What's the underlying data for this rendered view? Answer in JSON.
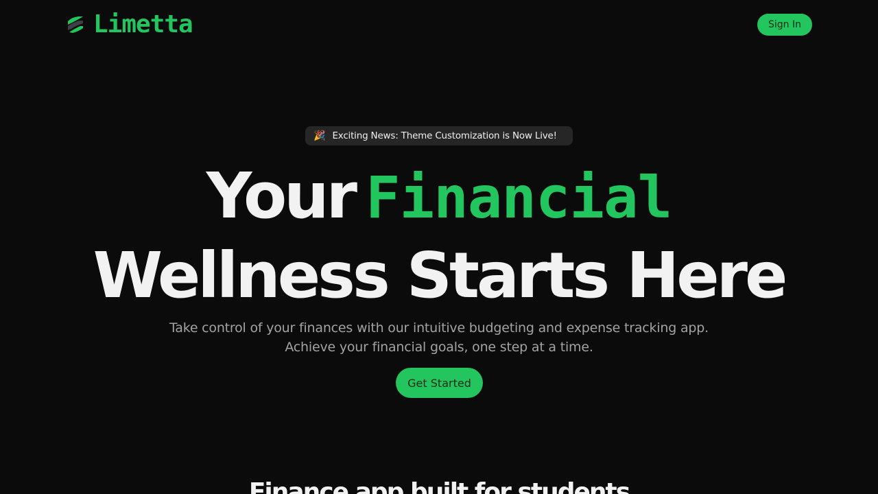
{
  "header": {
    "brand_name": "Limetta",
    "logo_icon": "limetta-logo-icon",
    "signin_label": "Sign In"
  },
  "announcement": {
    "icon": "party-popper-icon",
    "icon_glyph": "🎉",
    "text": "Exciting News: Theme Customization is Now Live!"
  },
  "hero": {
    "headline_line1_plain": "Your",
    "headline_line1_accent": "Financial",
    "headline_line2": "Wellness Starts Here",
    "subtitle": "Take control of your finances with our intuitive budgeting and expense tracking app. Achieve your financial goals, one step at a time.",
    "cta_label": "Get Started"
  },
  "next_section": {
    "heading": "Finance app built for students"
  },
  "colors": {
    "background": "#0b0b0b",
    "accent": "#22c55e",
    "text_primary": "#f2f2f2",
    "text_muted": "#a3a3a3",
    "pill_background": "#262626"
  }
}
